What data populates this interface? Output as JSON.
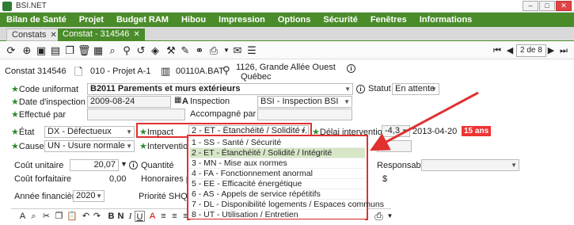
{
  "window": {
    "title": "BSI.NET"
  },
  "menu": [
    "Bilan de Santé",
    "Projet",
    "Budget RAM",
    "Hibou",
    "Impression",
    "Options",
    "Sécurité",
    "Fenêtres",
    "Informations"
  ],
  "tabs": [
    {
      "label": "Constats",
      "close": "✕"
    },
    {
      "label": "Constat - 314546",
      "close": "✕"
    }
  ],
  "pager": {
    "text": "2 de 8"
  },
  "header": {
    "constat": "Constat 314546",
    "projet": "010 - Projet  A-1",
    "batiment": "00110A.BAT",
    "adresse1": "1126,  Grande Allée Ouest",
    "adresse2": "Québec"
  },
  "form": {
    "code_uniformat_label": "Code uniformat",
    "code_uniformat_value": "B2011  Parements et murs extérieurs",
    "statut_label": "Statut",
    "statut_value": "En attente",
    "date_inspection_label": "Date d'inspection",
    "date_inspection_value": "2009-08-24",
    "date_suffix": "A",
    "inspection_label": "Inspection",
    "inspection_value": "BSI - Inspection BSI",
    "effectue_par_label": "Effectué par",
    "accompagne_par_label": "Accompagné par",
    "etat_label": "État",
    "etat_value": "DX - Défectueux",
    "impact_label": "Impact",
    "impact_value": "2 - ET - Étanchéité / Solidité /...",
    "delai_label": "Délai intervention",
    "delai_value": "-4,3",
    "delai_date": "2013-04-20",
    "delai_badge": "15 ans",
    "cause_label": "Cause",
    "cause_value": "UN - Usure normale",
    "intervention_label": "Intervention",
    "cout_unitaire_label": "Coût unitaire",
    "cout_unitaire_value": "20,07",
    "quantite_label": "Quantité",
    "responsable_label": "Responsable",
    "cout_forfaitaire_label": "Coût forfaitaire",
    "cout_forfaitaire_value": "0,00",
    "honoraires_label": "Honoraires pro",
    "dollar": "$",
    "annee_label": "Année financière",
    "annee_value": "2020",
    "priorite_label": "Priorité SHQ"
  },
  "impact_options": [
    "1 - SS - Santé / Sécurité",
    "2 - ET - Étanchéité / Solidité / Intégrité",
    "3 - MN - Mise aux normes",
    "4 - FA - Fonctionnement anormal",
    "5 - EE - Efficacité énergétique",
    "6 - AS - Appels de service répétitifs",
    "7 - DL - Disponibilité logements / Espaces communs",
    "8 - UT - Utilisation / Entretien"
  ],
  "editor": {
    "bold": "B",
    "italic": "I",
    "underline": "U",
    "strike": "N"
  },
  "colors": {
    "menu_green": "#4a8c2a",
    "highlight_red": "#e03030",
    "selected_option": "#d6e6c6",
    "badge_red": "#e33333"
  }
}
